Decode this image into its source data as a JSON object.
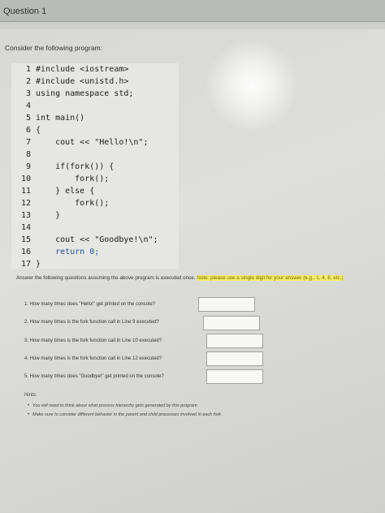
{
  "question_title": "Question 1",
  "intro": "Consider the following program:",
  "code_lines": [
    {
      "num": "1",
      "text": "#include <iostream>"
    },
    {
      "num": "2",
      "text": "#include <unistd.h>"
    },
    {
      "num": "3",
      "text": "using namespace std;"
    },
    {
      "num": "4",
      "text": ""
    },
    {
      "num": "5",
      "text": "int main()"
    },
    {
      "num": "6",
      "text": "{"
    },
    {
      "num": "7",
      "text": "    cout << \"Hello!\\n\";"
    },
    {
      "num": "8",
      "text": ""
    },
    {
      "num": "9",
      "text": "    if(fork()) {"
    },
    {
      "num": "10",
      "text": "        fork();"
    },
    {
      "num": "11",
      "text": "    } else {"
    },
    {
      "num": "12",
      "text": "        fork();"
    },
    {
      "num": "13",
      "text": "    }"
    },
    {
      "num": "14",
      "text": ""
    },
    {
      "num": "15",
      "text": "    cout << \"Goodbye!\\n\";"
    },
    {
      "num": "16",
      "text": "    return 0;"
    },
    {
      "num": "17",
      "text": "}"
    }
  ],
  "instructions": "Answer the following questions assuming the above program is executed once.",
  "note": "Note: please use a single digit for your answer (e.g., 1, 4, 8, etc.)",
  "questions": [
    {
      "label": "1. How many times does \"Hello!\" get printed on the console?",
      "value": ""
    },
    {
      "label": "2. How many times is the fork function call in Line 9 executed?",
      "value": ""
    },
    {
      "label": "3. How many times is the fork function call in Line 10 executed?",
      "value": ""
    },
    {
      "label": "4. How many times is the fork function call in Line 12 executed?",
      "value": ""
    },
    {
      "label": "5. How many times does \"Goodbye!\" get printed on the console?",
      "value": ""
    }
  ],
  "hints_title": "Hints:",
  "hints": [
    "You will need to think about what process hierarchy gets generated by this program",
    "Make sure to consider different behavior in the parent and child processes involved in each fork"
  ]
}
